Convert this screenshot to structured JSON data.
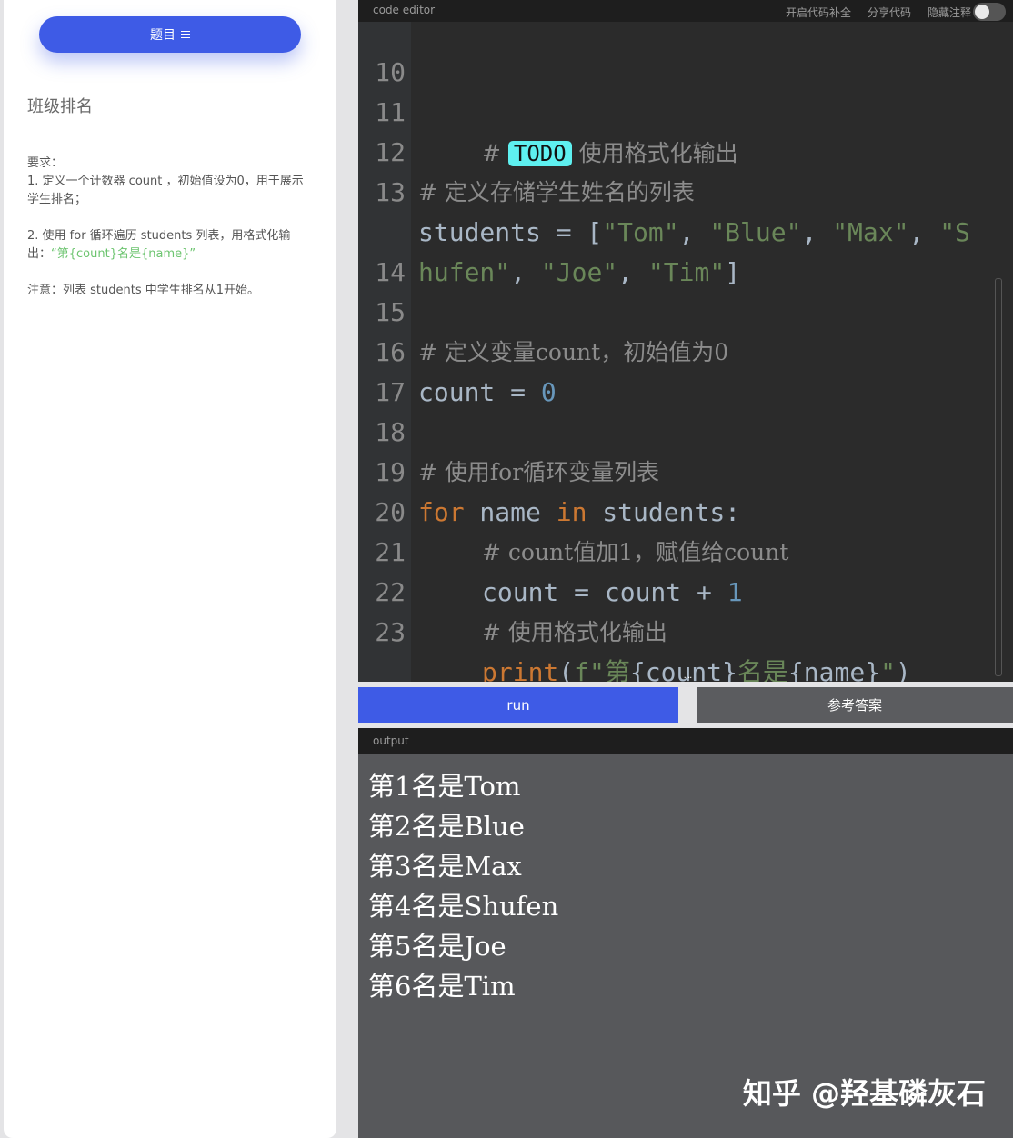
{
  "sidebar": {
    "tab_label": "题目",
    "title": "班级排名",
    "req_heading": "要求：",
    "req_1": "1. 定义一个计数器 count ，初始值设为0，用于展示学生排名；",
    "req_2_prefix": "2. 使用 for 循环遍历 students 列表，用格式化输出：",
    "req_2_format": "“第{count}名是{name}”",
    "note": "注意：列表 students 中学生排名从1开始。"
  },
  "editor": {
    "header_label": "code editor",
    "action_autocomplete": "开启代码补全",
    "action_share": "分享代码",
    "action_hide_comments": "隐藏注释",
    "line_numbers": [
      "10",
      "11",
      "12",
      "13",
      "",
      "14",
      "15",
      "16",
      "17",
      "18",
      "19",
      "20",
      "21",
      "22",
      "23"
    ],
    "code": {
      "l11_hash": "# ",
      "l11_todo": "TODO",
      "l11_text": " 使用格式化输出",
      "l12": "# 定义存储学生姓名的列表",
      "l13_a": "students = [",
      "l13_s1": "\"Tom\"",
      "l13_c1": ", ",
      "l13_s2": "\"Blue\"",
      "l13_c2": ", ",
      "l13_s3": "\"Max\"",
      "l13_c3": ", ",
      "l13_s4a": "\"S",
      "l13_s4b": "hufen\"",
      "l13_c4": ", ",
      "l13_s5": "\"Joe\"",
      "l13_c5": ", ",
      "l13_s6": "\"Tim\"",
      "l13_end": "]",
      "l15": "# 定义变量count，初始值为0",
      "l16_a": "count = ",
      "l16_num": "0",
      "l18": "# 使用for循环变量列表",
      "l19_for": "for",
      "l19_mid": " name ",
      "l19_in": "in",
      "l19_end": " students:",
      "l20": "# count值加1，赋值给count",
      "l21_a": "count = count + ",
      "l21_num": "1",
      "l22": "# 使用格式化输出",
      "l23_print": "print",
      "l23_open": "(",
      "l23_f": "f\"第",
      "l23_v1": "{count}",
      "l23_mid": "名是",
      "l23_v2": "{name}",
      "l23_q": "\"",
      "l23_close": ")"
    }
  },
  "buttons": {
    "run": "run",
    "answer": "参考答案"
  },
  "output": {
    "header_label": "output",
    "lines": [
      "第1名是Tom",
      "第2名是Blue",
      "第3名是Max",
      "第4名是Shufen",
      "第5名是Joe",
      "第6名是Tim"
    ]
  },
  "watermark": "知乎 @羟基磷灰石",
  "colors": {
    "accent": "#3e5be6",
    "keyword": "#cc7832",
    "string": "#6a8759",
    "number": "#6897bb",
    "todo_highlight": "#5ef0f0",
    "format_hint": "#6cc46f"
  }
}
